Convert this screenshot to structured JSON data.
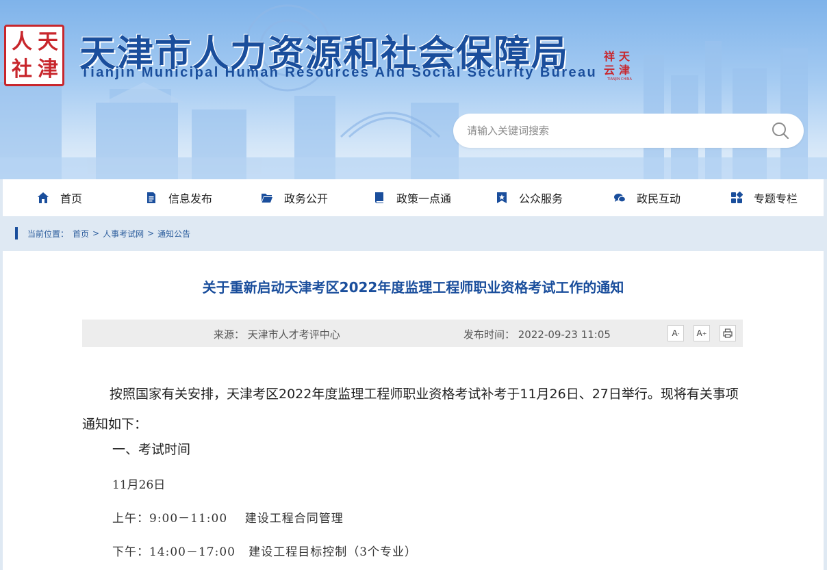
{
  "header": {
    "seal_chars": [
      "人",
      "天",
      "社",
      "津"
    ],
    "title_cn": "天津市人力资源和社会保障局",
    "title_en": "Tianjin Municipal Human Resources And Social Security Bureau",
    "mark_chars": [
      "天",
      "津"
    ],
    "mark_caption": "TIANJIN CHINA"
  },
  "search": {
    "placeholder": "请输入关键词搜索",
    "icon": "search-icon"
  },
  "nav": {
    "items": [
      {
        "label": "首页",
        "icon": "home-icon"
      },
      {
        "label": "信息发布",
        "icon": "document-icon"
      },
      {
        "label": "政务公开",
        "icon": "folder-icon"
      },
      {
        "label": "政策一点通",
        "icon": "book-icon"
      },
      {
        "label": "公众服务",
        "icon": "star-badge-icon"
      },
      {
        "label": "政民互动",
        "icon": "chat-icon"
      },
      {
        "label": "专题专栏",
        "icon": "grid-icon"
      }
    ]
  },
  "breadcrumb": {
    "prefix": "当前位置：",
    "items": [
      "首页",
      "人事考试网",
      "通知公告"
    ],
    "separator": ">"
  },
  "article": {
    "title": "关于重新启动天津考区2022年度监理工程师职业资格考试工作的通知",
    "source": "来源： 天津市人才考评中心",
    "publish_time": "发布时间： 2022-09-23 11:05",
    "tools": {
      "font_smaller": "A",
      "font_larger": "A",
      "print_icon": "print-icon"
    },
    "paragraphs": [
      "按照国家有关安排，天津考区2022年度监理工程师职业资格考试补考于11月26日、27日举行。现将有关事项通知如下：",
      "一、考试时间",
      "11月26日",
      "上午：9:00－11:00    建设工程合同管理",
      "下午：14:00－17:00   建设工程目标控制（3个专业）"
    ]
  },
  "colors": {
    "brand_blue": "#1a4e9c",
    "seal_red": "#c8262c",
    "nav_bg": "#ffffff",
    "meta_bg": "#ededed"
  }
}
